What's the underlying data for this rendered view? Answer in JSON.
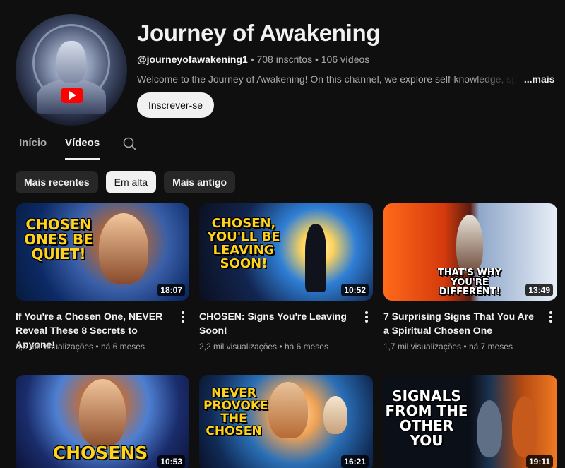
{
  "channel": {
    "name": "Journey of Awakening",
    "handle": "@journeyofawakening1",
    "subscribers": "708 inscritos",
    "video_count": "106 vídeos",
    "separator": "•",
    "description": "Welcome to the Journey of Awakening! On this channel, we explore self-knowledge, spirit",
    "more_label": "...mais",
    "subscribe_label": "Inscrever-se"
  },
  "tabs": [
    {
      "label": "Início",
      "active": false
    },
    {
      "label": "Vídeos",
      "active": true
    }
  ],
  "search_icon": "search-icon",
  "chips": [
    {
      "label": "Mais recentes",
      "selected": false
    },
    {
      "label": "Em alta",
      "selected": true
    },
    {
      "label": "Mais antigo",
      "selected": false
    }
  ],
  "videos": [
    {
      "title": "If You're a Chosen One, NEVER Reveal These 8 Secrets to Anyone!",
      "views": "3,6 mil visualizações",
      "age": "há 6 meses",
      "duration": "18:07",
      "thumb_text": "CHOSEN ONES BE QUIET!"
    },
    {
      "title": "CHOSEN: Signs You're Leaving Soon!",
      "views": "2,2 mil visualizações",
      "age": "há 6 meses",
      "duration": "10:52",
      "thumb_text": "CHOSEN, YOU'LL BE LEAVING SOON!"
    },
    {
      "title": "7 Surprising Signs That You Are a Spiritual Chosen One",
      "views": "1,7 mil visualizações",
      "age": "há 7 meses",
      "duration": "13:49",
      "thumb_text": "THAT'S WHY YOU'RE DIFFERENT!"
    },
    {
      "title": "",
      "views": "",
      "age": "",
      "duration": "10:53",
      "thumb_text": "CHOSENS"
    },
    {
      "title": "",
      "views": "",
      "age": "",
      "duration": "16:21",
      "thumb_text": "NEVER PROVOKE THE CHOSEN"
    },
    {
      "title": "",
      "views": "",
      "age": "",
      "duration": "19:11",
      "thumb_text": "SIGNALS FROM THE OTHER YOU"
    }
  ],
  "colors": {
    "background": "#0f0f0f",
    "chip_bg": "#272727",
    "chip_selected_bg": "#f1f1f1",
    "thumb_caption_yellow": "#ffd21c",
    "yt_red": "#ff0000"
  }
}
